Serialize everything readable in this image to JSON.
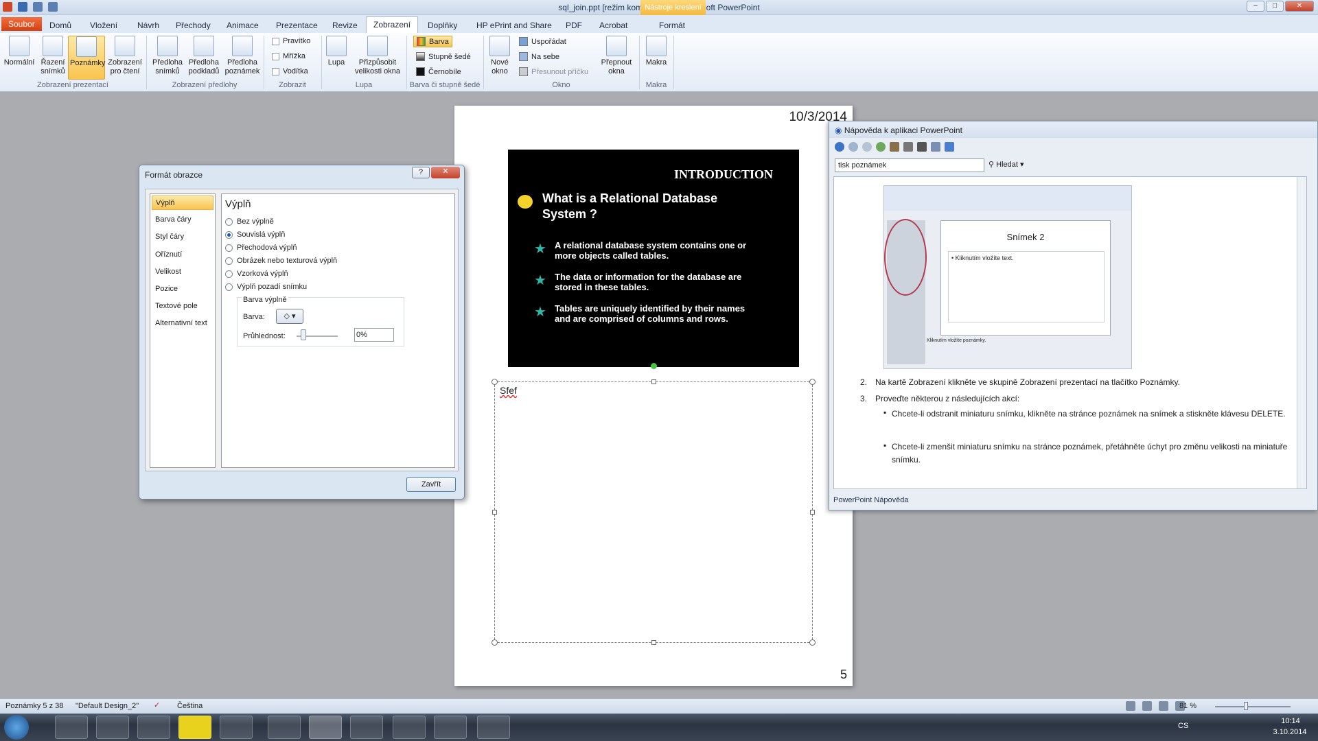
{
  "window": {
    "title": "sql_join.ppt [režim kompatibility] - Microsoft PowerPoint",
    "context_tab": "Nástroje kreslení"
  },
  "tabs": [
    "Soubor",
    "Domů",
    "Vložení",
    "Návrh",
    "Přechody",
    "Animace",
    "Prezentace",
    "Revize",
    "Zobrazení",
    "Doplňky",
    "HP ePrint and Share",
    "PDF",
    "Acrobat",
    "Formát"
  ],
  "ribbon": {
    "buttons": [
      "Normální",
      "Řazení snímků",
      "Poznámky",
      "Zobrazení pro čtení",
      "Předloha snímků",
      "Předloha podkladů",
      "Předloha poznámek",
      "Lupa",
      "Přizpůsobit velikosti okna",
      "Nové okno",
      "Přepnout okna",
      "Makra"
    ],
    "checks": [
      "Pravítko",
      "Mřížka",
      "Vodítka"
    ],
    "color": [
      "Barva",
      "Stupně šedé",
      "Černobíle"
    ],
    "window": [
      "Uspořádat",
      "Na sebe",
      "Přesunout příčku"
    ],
    "groups": [
      "Zobrazení prezentací",
      "Zobrazení předlohy",
      "Zobrazit",
      "Lupa",
      "Barva či stupně šedé",
      "Okno",
      "Makra"
    ]
  },
  "notes_page": {
    "date": "10/3/2014",
    "page_no": "5",
    "notes_text": "Sfef"
  },
  "slide": {
    "heading": "INTRODUCTION",
    "title": "What is a Relational Database System ?",
    "bullets": [
      "A relational database system contains one or more objects called tables.",
      "The data or information for the database are stored in these tables.",
      "Tables are uniquely identified by their names and are comprised of columns and rows."
    ]
  },
  "dialog": {
    "title": "Formát obrazce",
    "nav": [
      "Výplň",
      "Barva čáry",
      "Styl čáry",
      "Oříznutí",
      "Velikost",
      "Pozice",
      "Textové pole",
      "Alternativní text"
    ],
    "panel_title": "Výplň",
    "options": [
      "Bez výplně",
      "Souvislá výplň",
      "Přechodová výplň",
      "Obrázek nebo texturová výplň",
      "Vzorková výplň",
      "Výplň pozadí snímku"
    ],
    "group": "Barva výplně",
    "color_label": "Barva:",
    "transparency_label": "Průhlednost:",
    "transparency_value": "0%",
    "close": "Zavřít"
  },
  "help": {
    "title": "Nápověda k aplikaci PowerPoint",
    "search_value": "tisk poznámek",
    "search_btn": "Hledat",
    "thumb_slide_title": "Snímek 2",
    "thumb_bullet": "Kliknutím vložíte text.",
    "thumb_notes": "Kliknutím vložíte poznámky.",
    "step2": "Na kartě Zobrazení klikněte ve skupině Zobrazení prezentací na tlačítko Poznámky.",
    "step3": "Proveďte některou z následujících akcí:",
    "sub1": "Chcete-li odstranit miniaturu snímku, klikněte na stránce poznámek na snímek a stiskněte klávesu DELETE.",
    "sub2": "Chcete-li zmenšit miniaturu snímku na stránce poznámek, přetáhněte úchyt pro změnu velikosti na miniatuře snímku.",
    "footer": "PowerPoint Nápověda"
  },
  "status": {
    "page": "Poznámky 5 z 38",
    "theme": "\"Default Design_2\"",
    "lang": "Čeština",
    "zoom": "81 %"
  },
  "taskbar": {
    "lang": "CS",
    "time": "10:14",
    "date": "3.10.2014"
  }
}
